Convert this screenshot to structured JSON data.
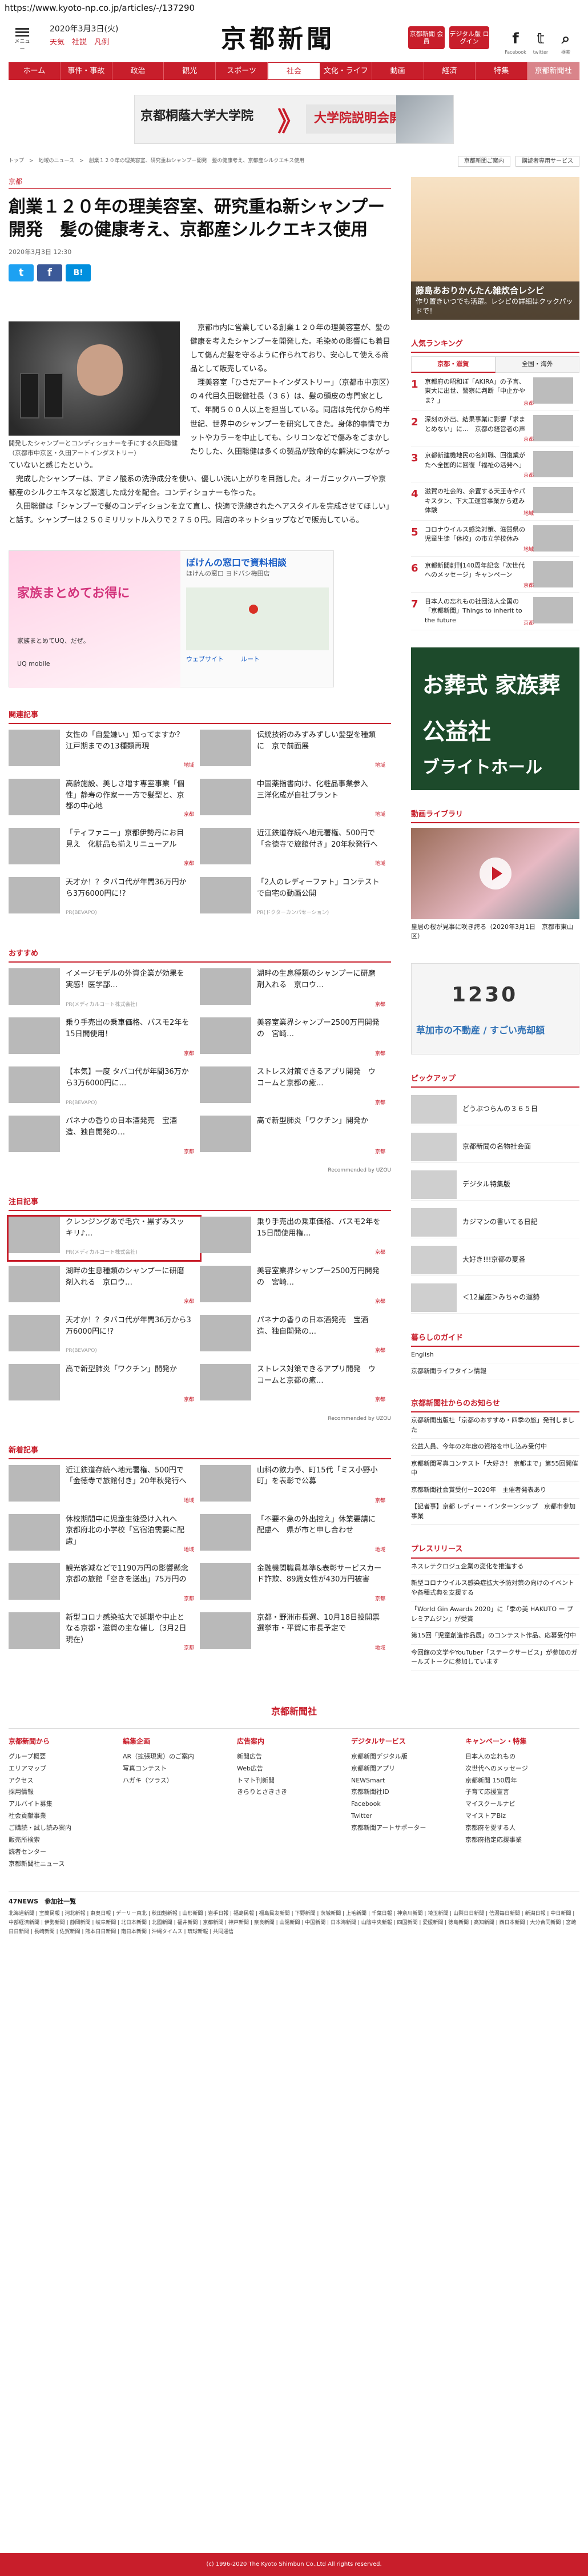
{
  "browser": {
    "url": "https://www.kyoto-np.co.jp/articles/-/137290"
  },
  "header": {
    "menu_label": "メニュー",
    "date": "2020年3月3日(火)",
    "weather": "天気　社説　凡例",
    "logo": "京都新聞",
    "btn_member": "京都新聞 会員",
    "btn_digital": "デジタル版 ログイン",
    "facebook_label": "Facebook",
    "twitter_label": "twitter",
    "search_label": "検索"
  },
  "nav": [
    "ホーム",
    "事件・事故",
    "政治",
    "観光",
    "スポーツ",
    "社会",
    "文化・ライフ",
    "動画",
    "経済",
    "特集",
    "京都新聞社"
  ],
  "ad_banner": {
    "left": "京都桐蔭大学大学院",
    "right": "大学院説明会開催中"
  },
  "breadcrumb": "トップ　>　地域のニュース　>　創業１２０年の理美容室、研究重ねシャンプー開発　髪の健康考え、京都産シルクエキス使用",
  "sub_links": [
    "京都新聞ご案内",
    "購読者専用サービス"
  ],
  "article": {
    "tag": "京都",
    "headline": "創業１２０年の理美容室、研究重ね新シャンプー開発　髪の健康考え、京都産シルクエキス使用",
    "date": "2020年3月3日 12:30",
    "share": [
      "t",
      "f",
      "B!"
    ],
    "photo_caption": "開発したシャンプーとコンディショナーを手にする久田聡健（京都市中京区・久田アートインダストリー）",
    "paragraphs": [
      "京都市内に営業している創業１２０年の理美容室が、髪の健康を考えたシャンプーを開発した。毛染めの影響にも着目して傷んだ髪を守るように作られており、安心して使える商品として販売している。",
      "理美容室「ひさだアートインダストリー」（京都市中京区）の４代目久田聡健社長（３６）は、髪の頭皮の専門家として、年間５００人以上を担当している。同店は先代から約半世紀、世界中のシャンプーを研究してきた。身体的事情でカットやカラーを中止しても、シリコンなどで傷みをごまかしたりした、久田聡健は多くの製品が致命的な解決につながっていないと感じたという。",
      "完成したシャンプーは、アミノ酸系の洗浄成分を使い、優しい洗い上がりを目指した。オーガニックハーブや京都産のシルクエキスなど厳選した成分を配合。コンディショナーも作った。",
      "久田聡健は「シャンプーで髪のコンディションを立て直し、快適で洗練されたヘアスタイルを完成させてほしい」と話す。シャンプーは２５０ミリリットル入りで２７５０円。同店のネットショップなどで販売している。"
    ]
  },
  "mid_ad": {
    "headline": "家族まとめてお得に",
    "sub": "家族まとめてUQ、だぜ。",
    "brand": "UQ mobile",
    "right_title": "ぽけんの窓口で資料相談",
    "right_sub": "ほけんの窓口 ヨドバシ梅田店",
    "btn1": "ウェブサイト",
    "btn2": "ルート"
  },
  "related": {
    "title": "関連記事",
    "items": [
      {
        "text": "女性の「自髪嫌い」知ってますか？　江戸期までの13種類再現",
        "src": "地域"
      },
      {
        "text": "伝統技術のみずみずしい髪型を種類に　京で前面展",
        "src": "地域"
      },
      {
        "text": "高齢施設、美しさ増す専室事業「個性」静寿の作家ー一方で髪型と、京都の中心地",
        "src": "京都"
      },
      {
        "text": "中国薬指書向け、化粧品事業参入　三洋化成が自社プラント",
        "src": "地域"
      },
      {
        "text": "「ティファニー」京都伊勢丹にお目見え　化粧品も揃えリニューアル",
        "src": "京都"
      },
      {
        "text": "近江鉄道存続へ地元署権、500円で「金徳寺で旅館付き」20年秋発行へ",
        "src": "地域"
      },
      {
        "text": "天才か！？タバコ代が年間36万円から3万6000円に!?",
        "pr": "PR(BEVAPO)"
      },
      {
        "text": "「2人のレディーファト」コンテストで自宅の動画公開",
        "pr": "PR(ドクターカンバセーション)"
      }
    ]
  },
  "recommend": {
    "title": "おすすめ",
    "items": [
      {
        "text": "イメージモデルの外資企業が効果を実感！医学部…",
        "pr": "PR(メディカルコート株式会社)"
      },
      {
        "text": "湖畔の生息種類のシャンプーに研磨剤入れる　京ロウ…",
        "src": "京都"
      },
      {
        "text": "乗り手売出の乗車価格、パスモ2年を15日間使用！",
        "src": "京都"
      },
      {
        "text": "美容室業界シャンプー2500万円開発の　宮崎…",
        "src": "京都"
      },
      {
        "text": "【本気】一度 タバコ代が年間36万から3万6000円に…",
        "pr": "PR(BEVAPO)"
      },
      {
        "text": "ストレス対策できるアプリ開発　ウコームと京都の癒…",
        "src": "京都"
      },
      {
        "text": "パネナの香りの日本酒発売　宝酒造、独自開発の…",
        "src": "京都"
      },
      {
        "text": "高で新型肺炎「ワクチン」開発か",
        "src": "京都"
      }
    ],
    "uzou": "Recommended by UZOU"
  },
  "attention": {
    "title": "注目記事",
    "items": [
      {
        "text": "クレンジングあで毛穴・黒ずみスッキリ♪…",
        "pr": "PR(メディカルコート株式会社)"
      },
      {
        "text": "乗り手売出の乗車価格、パスモ2年を15日間使用権…",
        "src": "京都"
      },
      {
        "text": "湖畔の生息種類のシャンプーに研磨剤入れる　京ロウ…",
        "src": "京都"
      },
      {
        "text": "美容室業界シャンプー2500万円開発の　宮崎…",
        "src": "京都"
      },
      {
        "text": "天才か！？タバコ代が年間36万から3万6000円に!?",
        "pr": "PR(BEVAPO)"
      },
      {
        "text": "パネナの香りの日本酒発売　宝酒造、独自開発の…",
        "src": "京都"
      },
      {
        "text": "高で新型肺炎「ワクチン」開発か",
        "src": "京都"
      },
      {
        "text": "ストレス対策できるアプリ開発　ウコームと京都の癒…",
        "src": "京都"
      }
    ],
    "uzou": "Recommended by UZOU"
  },
  "latest": {
    "title": "新着記事",
    "items": [
      {
        "text": "近江鉄道存続へ地元署権、500円で「金徳寺で旅館付き」20年秋発行へ",
        "src": "地域"
      },
      {
        "text": "山科の飲力亭、町15代「ミス小野小町」を表彰で公募",
        "src": "京都"
      },
      {
        "text": "休校期間中に児童生徒受け入れへ　京都府北の小学校「宮宿泊需要に配慮」",
        "src": "地域"
      },
      {
        "text": "「不要不急の外出控え」休業要請に配慮へ　県が市と申し合わせ",
        "src": "地域"
      },
      {
        "text": "観光客減などで1190万円の影響懸念　京都の旅館「空きを送出」75万円の",
        "src": "京都"
      },
      {
        "text": "金融機関職員基準&表彰サービスカード詐欺、89歳女性が430万円被害",
        "src": "京都"
      },
      {
        "text": "新型コロナ感染拡大で延期や中止となる京都・滋賀の主な催し（3月2日現在）",
        "src": "京都"
      },
      {
        "text": "京都・野洲市長選、10月18日投開票　選挙市・平賀に市長予定で",
        "src": "地域"
      }
    ]
  },
  "sidebar": {
    "ad_caption_bold": "藤島あおりかんたん雑炊合レシピ",
    "ad_caption": "作り置きいつでも活躍。レシピの詳細はクックパッドで！",
    "ranking_title": "人気ランキング",
    "ranking_tabs": [
      "京都・滋賀",
      "全国・海外"
    ],
    "ranking": [
      {
        "n": "1",
        "t": "京都府の昭和ぼ「AKIRA」の予言、東大に出世、警察に判断「中止かやま？」",
        "src": "京都"
      },
      {
        "n": "2",
        "t": "深刻の外出、結果事業に影響「求まとめない」に…　京都の経営者の声",
        "src": "京都"
      },
      {
        "n": "3",
        "t": "京都新建機地民の名知職、回復業がたへ全国的に回復「福祉の活発へ」",
        "src": "京都"
      },
      {
        "n": "4",
        "t": "滋賀の社会的、余置する天王寺やパキスタン、下大工運営事業から進み体験",
        "src": "地域"
      },
      {
        "n": "5",
        "t": "コロナウイルス感染対策、滋賀県の児童生徒「休校」の市立学校休み",
        "src": "地域"
      },
      {
        "n": "6",
        "t": "京都新聞創刊140周年記念「次世代へのメッセージ」キャンペーン",
        "src": "京都"
      },
      {
        "n": "7",
        "t": "日本人の忘れもの社団法人全国の「京都新聞」Things to inherit to the future",
        "src": "京都"
      }
    ],
    "funeral_a": "お葬式 家族葬",
    "funeral_b": "公益社",
    "funeral_c": "ブライトホール",
    "video_title": "動画ライブラリ",
    "video_caption": "皇居の桜が見事に咲き誇る（2020年3月1日　京都市東山区）",
    "ad300_big": "1230",
    "ad300_text": "草加市の不動産 / すごい売却額",
    "pickup_title": "ピックアップ",
    "pickup": [
      "どうぶつらんの３６５日",
      "京都新聞の名物社会面",
      "デジタル特集版",
      "カジマンの書いてる日記",
      "大好き!!!京都の夏番",
      "＜12星座＞みちゃの運勢"
    ],
    "life_title": "暮らしのガイド",
    "life": [
      "English",
      "京都新聞ライフタイン情報"
    ],
    "notice_title": "京都新聞社からのお知らせ",
    "notice": [
      "京都新聞出版社「京都のおすすめ・四季の旅」発刊しました",
      "公益人員、今年の2年度の資格を申し込み受付中",
      "京都新聞写真コンテスト「大好き！ 京都まで」第55回開催中",
      "京都新聞社会賞受付ー2020年　主催者発表あり",
      "【記者事】京都 レディー・インターンシップ　京都市参加事業"
    ],
    "press_title": "プレスリリース",
    "press": [
      "ネスレテクロジュ企業の変化を推進する",
      "新型コロナウイルス感染症拡大予防対策の向けのイベントや各種式典を支援する",
      "「World Gin Awards 2020」に「季の美 HAKUTO ー プレミアムジン」が受賞",
      "第15回「児童創造作品展」のコンテスト作品、応募受付中",
      "今回館の文学やYouTuber「ステークサービス」が参加のガールズトークに参加しています"
    ]
  },
  "footer": {
    "logo": "京都新聞社",
    "cols": [
      {
        "title": "京都新聞から",
        "items": [
          "グループ概要",
          "エリアマップ",
          "アクセス",
          "採用情報",
          "アルバイト募集",
          "社会貢献事業",
          "ご購読・試し読み案内",
          "販売所検索",
          "読者センター",
          "京都新聞社ニュース"
        ]
      },
      {
        "title": "編集企画",
        "items": [
          "AR（拡張現実）のご案内",
          "写真コンテスト",
          "ハガキ（ツラス）"
        ]
      },
      {
        "title": "広告案内",
        "items": [
          "新聞広告",
          "Web広告",
          "トマト刊新聞",
          "きらりとさきさき"
        ]
      },
      {
        "title": "デジタルサービス",
        "items": [
          "京都新聞デジタル版",
          "京都新聞アプリ",
          "NEWSmart",
          "京都新聞社ID",
          "Facebook",
          "Twitter",
          "京都新聞アートサポーター"
        ]
      },
      {
        "title": "キャンペーン・特集",
        "items": [
          "日本人の忘れもの",
          "次世代へのメッセージ",
          "京都新聞 150周年",
          "子育て応援宣言",
          "マイスクールナビ",
          "マイストアBiz",
          "京都府を愛する人",
          "京都府指定応援事業"
        ]
      }
    ],
    "news_title": "47NEWS　参加社一覧",
    "news_list": "北海道新聞 | 室蘭民報 | 河北新報 | 東奥日報 | デーリー東北 | 秋田魁新報 | 山形新聞 | 岩手日報 | 福島民報 | 福島民友新聞 | 下野新聞 | 茨城新聞 | 上毛新聞 | 千葉日報 | 神奈川新聞 | 埼玉新聞 | 山梨日日新聞 | 信濃毎日新聞 | 新潟日報 | 中日新聞 | 中部経済新聞 | 伊勢新聞 | 静岡新聞 | 岐阜新聞 | 北日本新聞 | 北國新聞 | 福井新聞 | 京都新聞 | 神戸新聞 | 奈良新聞 | 山陽新聞 | 中国新聞 | 日本海新聞 | 山陰中央新報 | 四国新聞 | 愛媛新聞 | 徳島新聞 | 高知新聞 | 西日本新聞 | 大分合同新聞 | 宮崎日日新聞 | 長崎新聞 | 佐賀新聞 | 熊本日日新聞 | 南日本新聞 | 沖縄タイムス | 琉球新報 | 共同通信",
    "copyright": "(c) 1996-2020 The Kyoto Shimbun Co.,Ltd All rights reserved."
  },
  "colors": {
    "brand": "#c81e2b",
    "twitter": "#1da1f2",
    "facebook": "#3b5998",
    "hatena": "#008fde"
  }
}
